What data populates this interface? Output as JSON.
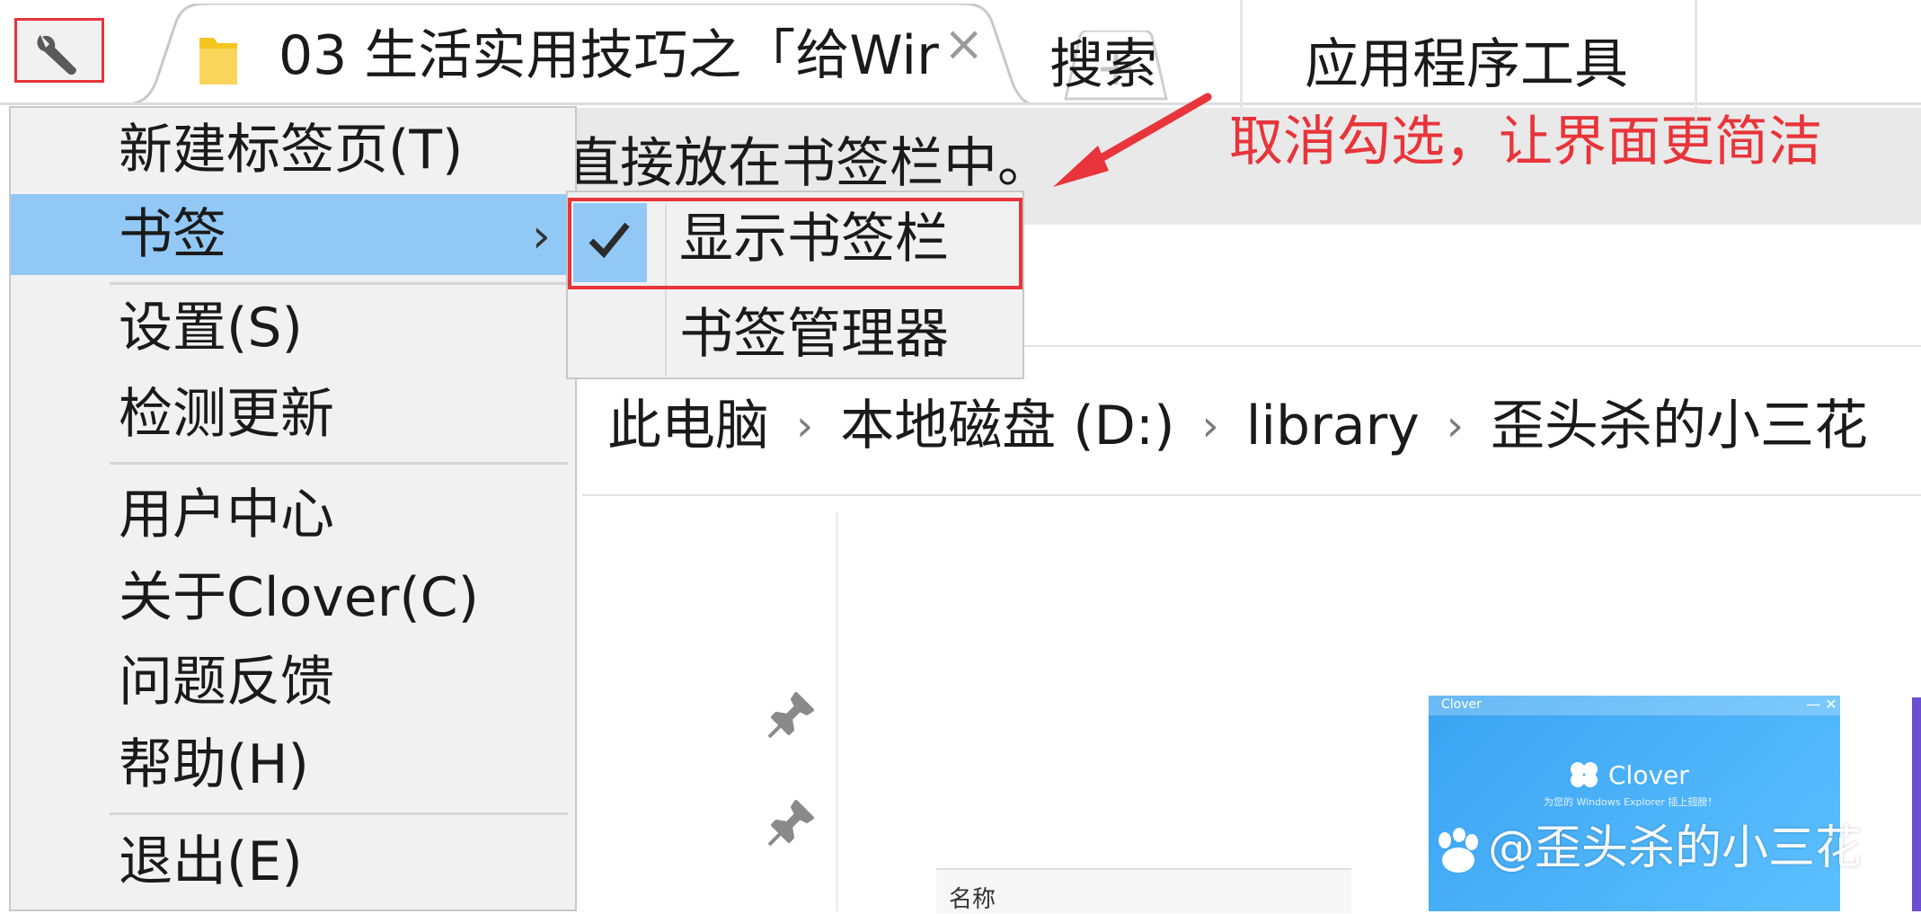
{
  "browser": {
    "tab_title": "03 生活实用技巧之「给Wir",
    "tab_close_symbol": "×",
    "new_tab_symbol": "+"
  },
  "bookmark_bar": {
    "hint_text": "直接放在书签栏中。"
  },
  "annotation": {
    "text": "取消勾选，让界面更简洁",
    "color": "#e8343a"
  },
  "ribbon": {
    "tabs": [
      "搜索",
      "应用程序工具"
    ]
  },
  "address_bar": {
    "crumbs": [
      "此电脑",
      "本地磁盘 (D:)",
      "library",
      "歪头杀的小三花"
    ],
    "separator": "›"
  },
  "file_list": {
    "column_name": "名称"
  },
  "thumbnail": {
    "app_name": "Clover",
    "title": "Clover",
    "subtitle": "为您的 Windows Explorer 插上翅膀！",
    "controls": "— ✕"
  },
  "watermark": {
    "text": "@歪头杀的小三花"
  },
  "main_menu": {
    "items": [
      {
        "label": "新建标签页(T)"
      },
      {
        "label": "书签",
        "has_submenu": true,
        "highlighted": true
      },
      {
        "label": "设置(S)"
      },
      {
        "label": "检测更新"
      },
      {
        "label": "用户中心"
      },
      {
        "label": "关于Clover(C)"
      },
      {
        "label": "问题反馈"
      },
      {
        "label": "帮助(H)"
      },
      {
        "label": "退出(E)"
      }
    ],
    "submenu_chevron": "›"
  },
  "bookmarks_submenu": {
    "items": [
      {
        "label": "显示书签栏",
        "checked": true
      },
      {
        "label": "书签管理器",
        "checked": false
      }
    ]
  },
  "colors": {
    "highlight": "#92c8f6",
    "annotation_red": "#e8343a",
    "menu_bg": "#f1f1f1"
  }
}
